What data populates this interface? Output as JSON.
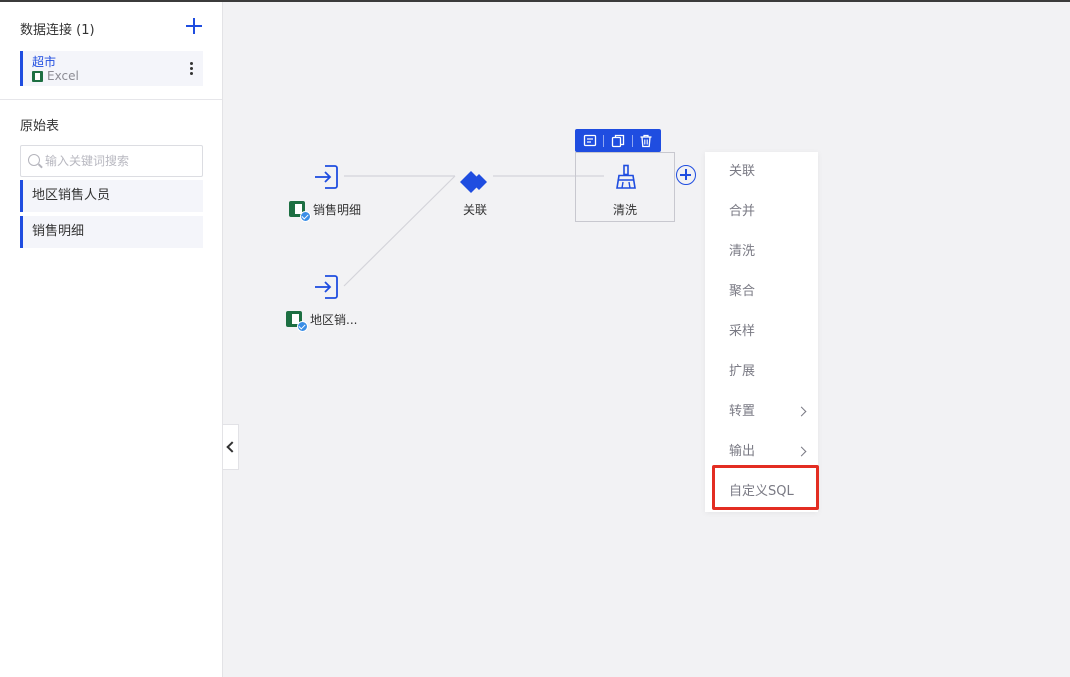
{
  "sidebar": {
    "connections_title": "数据连接 (1)",
    "add_icon": "plus-icon",
    "connection": {
      "name": "超市",
      "type": "Excel"
    },
    "raw_tables_title": "原始表",
    "search_placeholder": "输入关键词搜索",
    "tables": [
      {
        "label": "地区销售人员"
      },
      {
        "label": "销售明细"
      }
    ]
  },
  "canvas": {
    "nodes": {
      "input_sales_detail": {
        "label": "销售明细",
        "icon": "input-arrow-icon"
      },
      "input_region_sales": {
        "label": "地区销...",
        "icon": "input-arrow-icon"
      },
      "join": {
        "label": "关联",
        "icon": "diamond-icon"
      },
      "clean": {
        "label": "清洗",
        "icon": "broom-icon"
      }
    },
    "toolbar_icons": [
      "note-icon",
      "copy-icon",
      "trash-icon"
    ]
  },
  "menu": {
    "items": [
      {
        "label": "关联",
        "has_submenu": false
      },
      {
        "label": "合并",
        "has_submenu": false
      },
      {
        "label": "清洗",
        "has_submenu": false
      },
      {
        "label": "聚合",
        "has_submenu": false
      },
      {
        "label": "采样",
        "has_submenu": false
      },
      {
        "label": "扩展",
        "has_submenu": false
      },
      {
        "label": "转置",
        "has_submenu": true
      },
      {
        "label": "输出",
        "has_submenu": true
      },
      {
        "label": "自定义SQL",
        "has_submenu": false,
        "highlighted": true
      }
    ]
  },
  "colors": {
    "accent": "#1f4de0",
    "highlight": "#e32d22",
    "excel": "#1d6f42"
  }
}
